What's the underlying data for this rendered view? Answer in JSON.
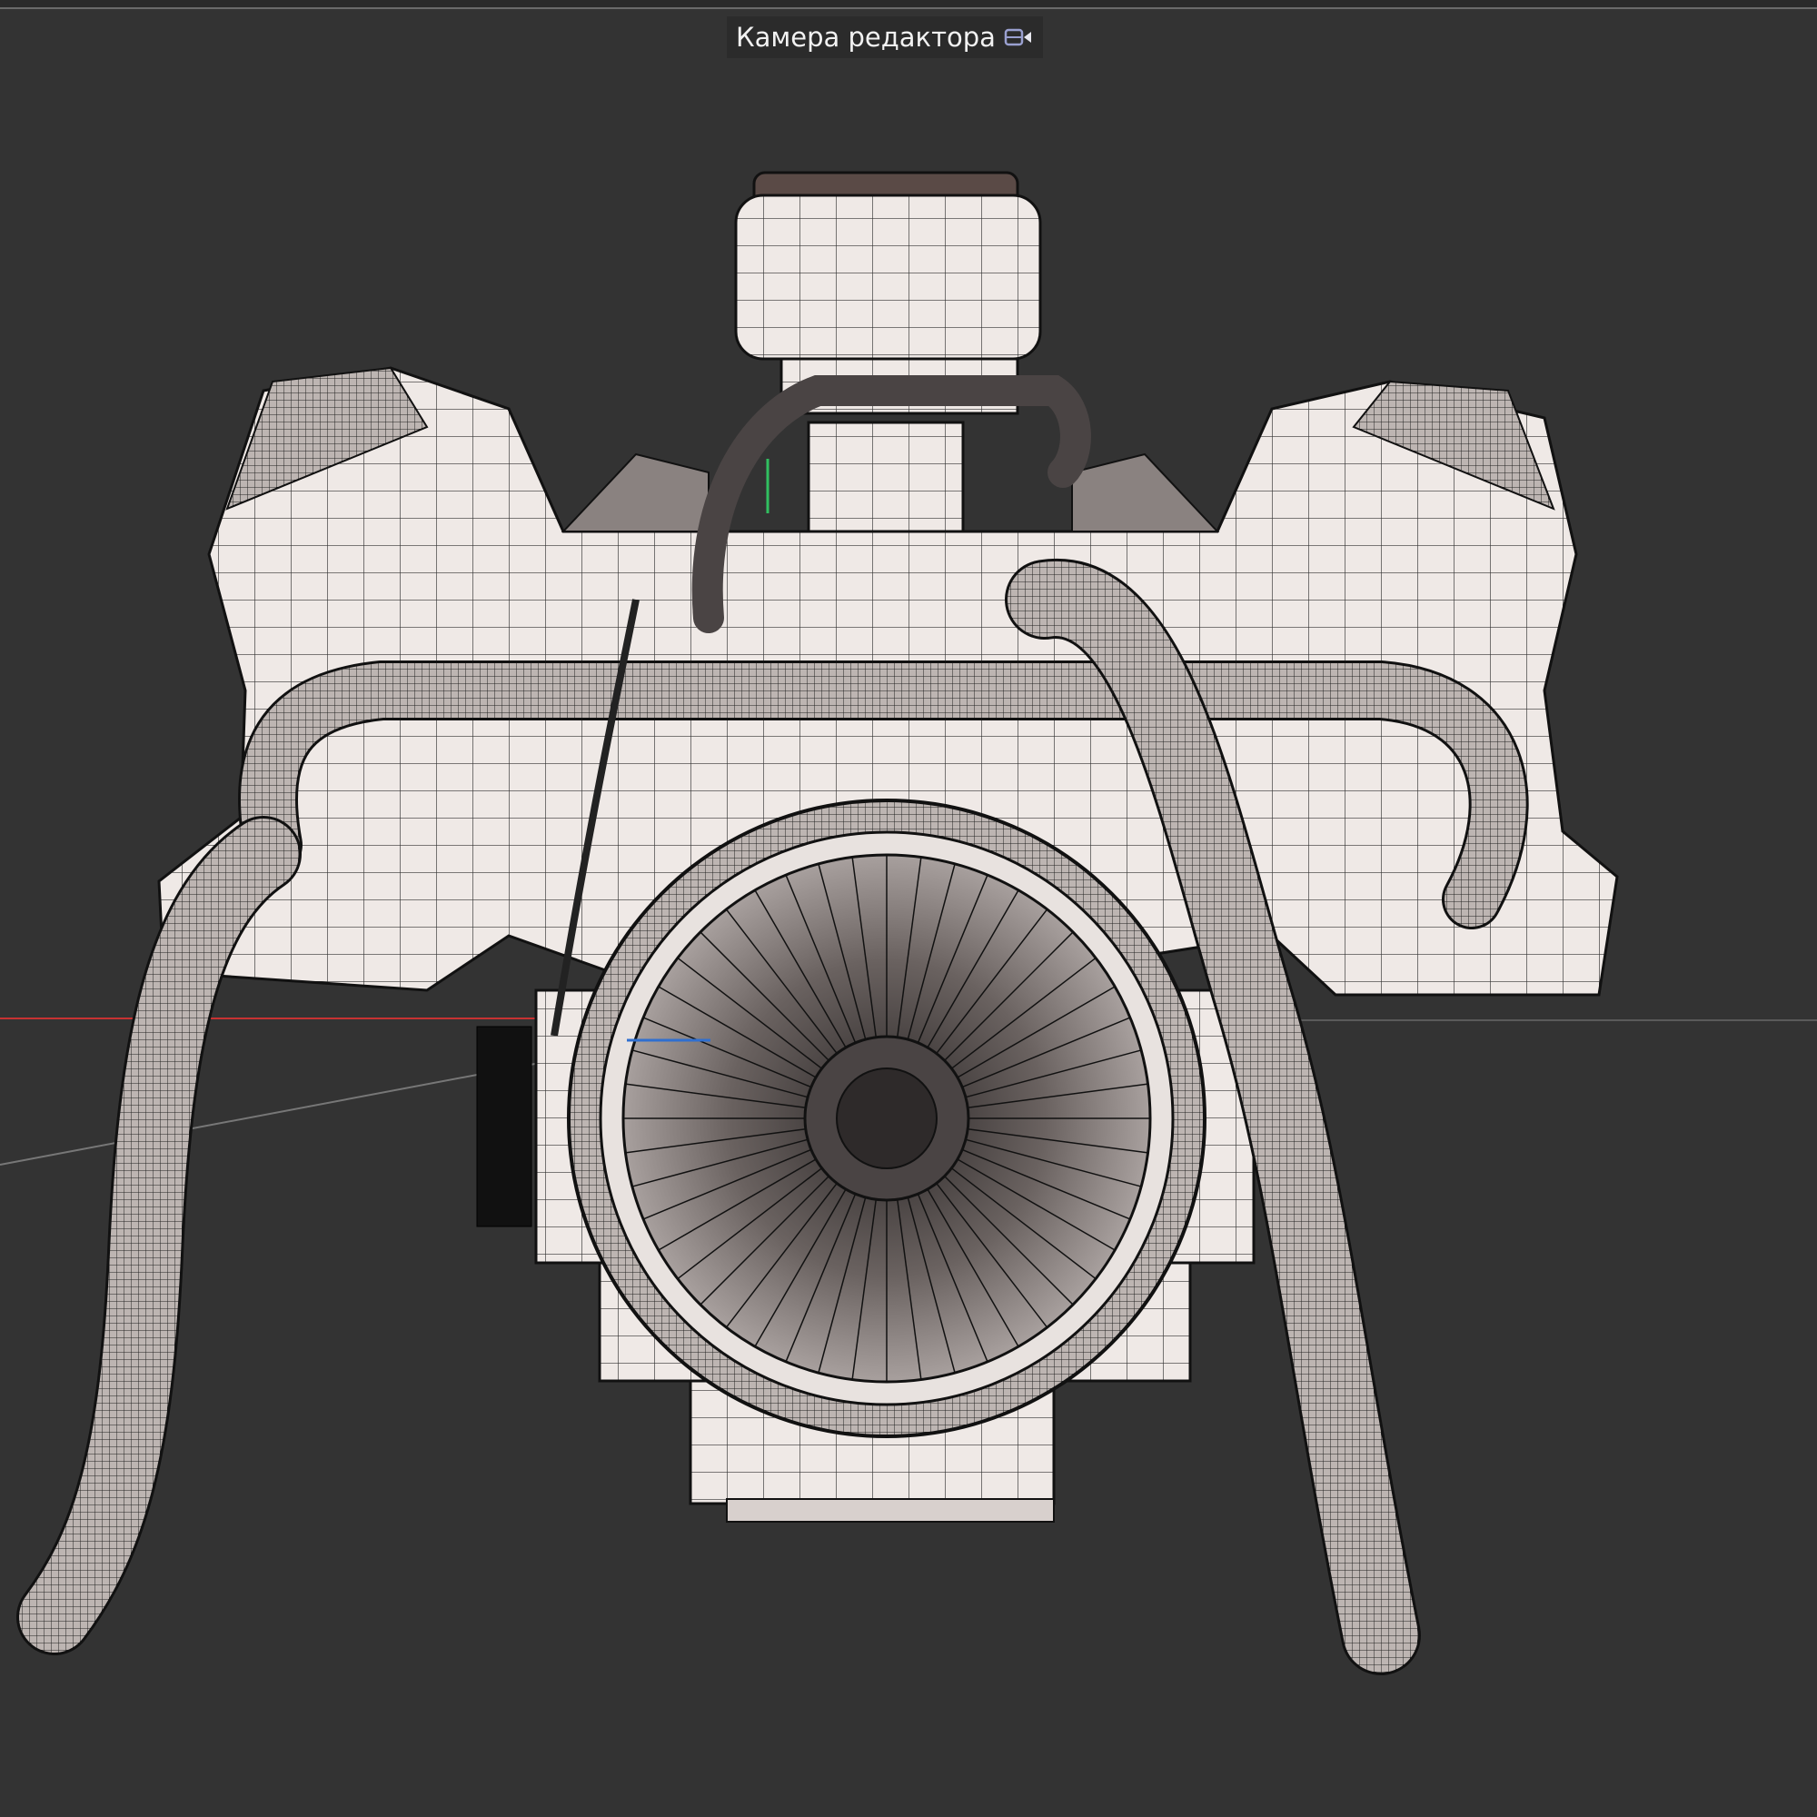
{
  "viewport": {
    "camera_label": "Камера редактора",
    "camera_icon": "camera-icon",
    "colors": {
      "background": "#333333",
      "x_axis": "#c83232",
      "z_axis": "#2f6fd0",
      "y_axis": "#30c060",
      "model_fill": "#ece6e3",
      "wire": "#1a1a1a"
    }
  }
}
